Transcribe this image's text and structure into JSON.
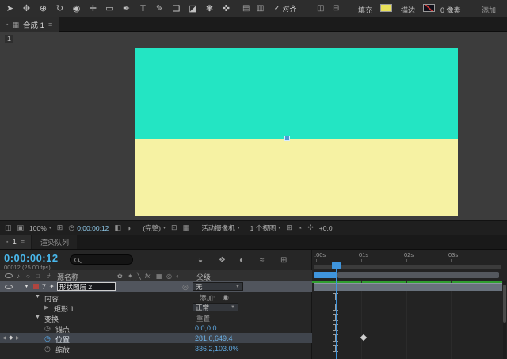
{
  "colors": {
    "accent_blue": "#3f95dd",
    "value_blue": "#5fa8e0",
    "timecode_cyan": "#49b8ec",
    "comp_top_cyan": "#23e5c3",
    "comp_bottom_yellow": "#f6f2a3",
    "fill_swatch_yellow": "#e8e05a",
    "cache_green": "#2f9e2f",
    "label_red": "#b0453f"
  },
  "toolbar": {
    "tools": [
      "➤",
      "✥",
      "⊕",
      "↻",
      "◉",
      "✛",
      "▭",
      "✒",
      "T",
      "✎",
      "❏",
      "◪",
      "✾",
      "✜"
    ],
    "mid_icons": [
      "▤",
      "▥"
    ],
    "align_check": "✓",
    "align_label": "对齐",
    "post_icons": [
      "◫",
      "⊟"
    ],
    "fill_label": "填充",
    "stroke_label": "描边",
    "stroke_width": "0 像素",
    "right_label": "添加"
  },
  "comp_panel": {
    "dot": "▪",
    "panel_icon": "▦",
    "title": "合成 1",
    "menu": "≡",
    "nav": "1"
  },
  "viewer_bar": {
    "icon_a1": "◫",
    "icon_a2": "▣",
    "zoom": "100%",
    "caret": "▾",
    "grid_icon": "⊞",
    "clock_icon": "◷",
    "timecode": "0:00:00:12",
    "snapshot_icon": "◧",
    "channels_icon": "◑",
    "resolution": "(完整)",
    "roi_icon": "⊡",
    "tgrid_icon": "▦",
    "camera": "活动摄像机",
    "views": "1 个视图",
    "icon_b1": "⊞",
    "icon_b2": "◔",
    "icon_b3": "✣",
    "exposure": "+0.0"
  },
  "timeline_tabs": {
    "dot": "▪",
    "comp_tab": "1",
    "menu": "≡",
    "render_tab": "渲染队列"
  },
  "timeline": {
    "timecode": "0:00:00:12",
    "frame_info": "00012 (25.00 fps)",
    "header_icons": [
      "◒",
      "❖",
      "◐",
      "≈",
      "⊞"
    ],
    "ruler": [
      ":00s",
      "01s",
      "02s",
      "03s"
    ],
    "columns": {
      "audio": "♪",
      "solo": "○",
      "lock": "□",
      "hash": "#",
      "source_name": "源名称",
      "switch_icons": [
        "✿",
        "✦",
        "╲",
        "fx",
        "▦",
        "◎",
        "◐"
      ],
      "parent": "父级"
    },
    "layer": {
      "twirl": "▼",
      "number": "7",
      "icon": "✦",
      "name": "形状图层 2",
      "pickwhip": "◎",
      "parent": "无",
      "caret": "▼"
    },
    "rows": {
      "contents": {
        "twirl": "▼",
        "name": "内容",
        "add_label": "添加:",
        "add_icon": "◉"
      },
      "rect": {
        "twirl": "▶",
        "name": "矩形 1",
        "blend": "正常",
        "caret": "▼"
      },
      "transform": {
        "twirl": "▼",
        "name": "变换",
        "reset": "重置"
      },
      "anchor": {
        "stopwatch": "◷",
        "name": "锚点",
        "value": "0.0,0.0"
      },
      "position": {
        "nav_prev": "◀",
        "nav_kf": "◆",
        "nav_next": "▶",
        "stopwatch": "◷",
        "name": "位置",
        "value": "281.0,649.4"
      },
      "scale": {
        "stopwatch": "◷",
        "name": "缩放",
        "value": "336.2,103.0%"
      }
    }
  }
}
